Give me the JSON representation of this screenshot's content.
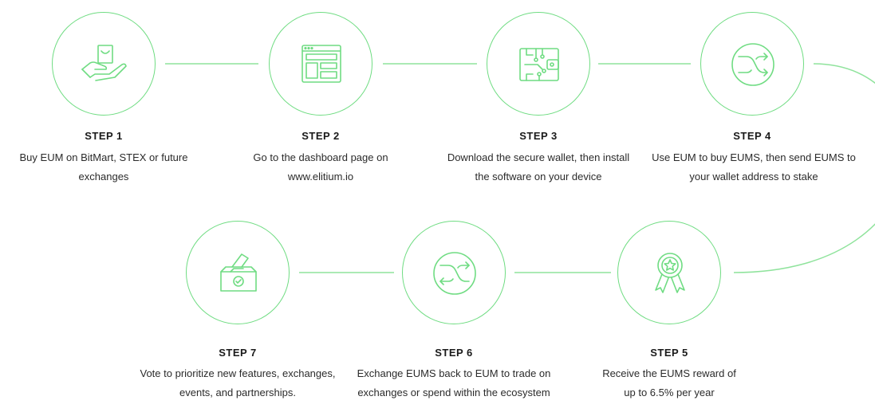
{
  "colors": {
    "accent": "#6fdc82",
    "text": "#2b2b2b"
  },
  "steps": [
    {
      "title": "STEP 1",
      "desc": "Buy EUM on BitMart, STEX or future exchanges",
      "icon": "hand-shopping-bag-icon"
    },
    {
      "title": "STEP 2",
      "desc": "Go to the dashboard page on www.elitium.io",
      "icon": "dashboard-icon"
    },
    {
      "title": "STEP 3",
      "desc": "Download the secure wallet, then install the software on your device",
      "icon": "circuit-wallet-icon"
    },
    {
      "title": "STEP 4",
      "desc": "Use EUM to buy EUMS, then send EUMS to your wallet address to stake",
      "icon": "exchange-arrows-icon"
    },
    {
      "title": "STEP 5",
      "desc": "Receive the EUMS reward of up to 6.5% per year",
      "icon": "award-ribbon-icon"
    },
    {
      "title": "STEP 6",
      "desc": "Exchange EUMS back to EUM to trade on exchanges or spend within the ecosystem",
      "icon": "exchange-arrows-icon"
    },
    {
      "title": "STEP 7",
      "desc": "Vote to prioritize new features, exchanges, events, and partnerships.",
      "icon": "ballot-box-icon"
    }
  ]
}
